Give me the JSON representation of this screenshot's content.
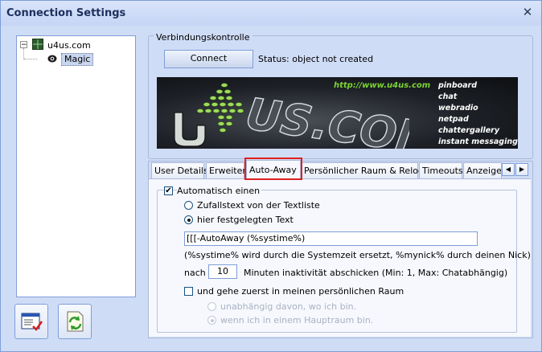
{
  "window": {
    "title": "Connection Settings"
  },
  "tree": {
    "root": {
      "label": "u4us.com",
      "expander": "−"
    },
    "child": {
      "label": "Magic"
    }
  },
  "connection": {
    "legend": "Verbindungskontrolle",
    "connect_label": "Connect",
    "status_text": "Status: object not created"
  },
  "banner": {
    "url": "http://www.u4us.com",
    "logo_text": "US.COM",
    "features": [
      "pinboard",
      "chat",
      "webradio",
      "netpad",
      "chattergallery",
      "instant messaging"
    ]
  },
  "tabs": {
    "items": [
      "User Details",
      "Erweitert",
      "Auto-Away",
      "Persönlicher Raum & Relogin",
      "Timeouts",
      "Anzeige"
    ],
    "active": "Auto-Away",
    "scroll_left": "◀",
    "scroll_right": "▶"
  },
  "auto_away": {
    "auto_checkbox_label": "Automatisch einen",
    "auto_checked": true,
    "radio_random_label": "Zufallstext von der Textliste",
    "radio_fixed_label": "hier festgelegten Text",
    "selected_radio": "fixed",
    "text_value": "[[[-AutoAway (%systime%)",
    "hint": "(%systime% wird durch die Systemzeit ersetzt, %mynick% durch deinen Nick)",
    "after_label": "nach",
    "minutes_value": "10",
    "minutes_suffix": "Minuten inaktivität abschicken (Min: 1, Max: Chatabhängig)",
    "personal_room_label": "und gehe zuerst in meinen persönlichen Raum",
    "personal_room_checked": false,
    "sub_radio_independent": "unabhängig davon, wo ich bin.",
    "sub_radio_main_room": "wenn ich in einem Hauptraum bin."
  },
  "icons": {
    "close": "close-icon",
    "properties": "window-check-icon",
    "refresh": "refresh-icon"
  },
  "colors": {
    "window_bg": "#cfdcf6",
    "highlight": "#e02020",
    "banner_green": "#7bd433"
  }
}
